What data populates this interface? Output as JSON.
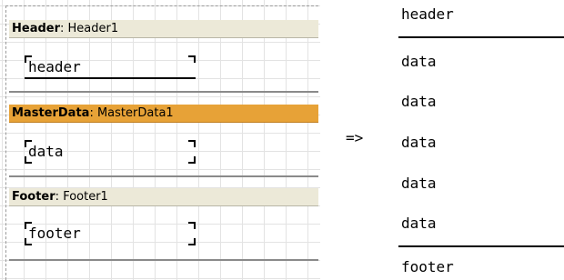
{
  "designer": {
    "bands": [
      {
        "type": "Header",
        "name": "Header1",
        "text": "header",
        "selected": false
      },
      {
        "type": "MasterData",
        "name": "MasterData1",
        "text": "data",
        "selected": true
      },
      {
        "type": "Footer",
        "name": "Footer1",
        "text": "footer",
        "selected": false
      }
    ]
  },
  "arrow": "=>",
  "result": {
    "header": "header",
    "rows": [
      "data",
      "data",
      "data",
      "data",
      "data"
    ],
    "footer": "footer"
  },
  "colors": {
    "band_header_bg": "#ece9d8",
    "selected_band_bg": "#e7a237",
    "grid_line": "#e3e3e3"
  }
}
